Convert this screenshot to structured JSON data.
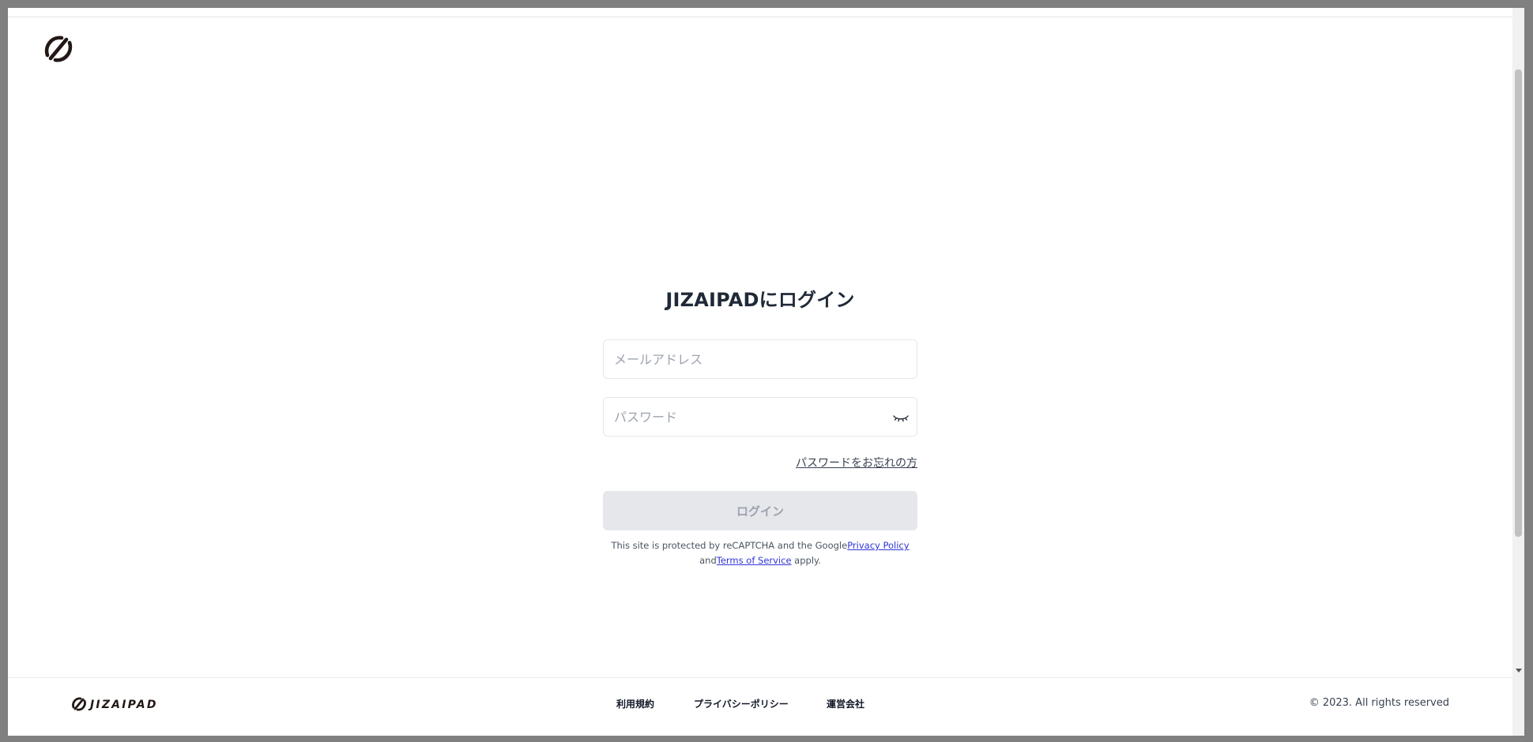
{
  "header": {
    "logo_icon": "jizaipad-mark-icon"
  },
  "login": {
    "title": "JIZAIPADにログイン",
    "email_placeholder": "メールアドレス",
    "password_placeholder": "パスワード",
    "password_toggle_icon": "eye-closed-icon",
    "forgot_password_label": "パスワードをお忘れの方",
    "submit_label": "ログイン",
    "submit_state": "disabled"
  },
  "recaptcha": {
    "text_before_privacy": "This site is protected by reCAPTCHA and the Google",
    "privacy_link_label": "Privacy Policy",
    "text_before_terms": "and",
    "terms_link_label": "Terms of Service",
    "text_after_terms": " apply."
  },
  "footer": {
    "brand_wordmark": "JIZAIPAD",
    "links": [
      {
        "label": "利用規約"
      },
      {
        "label": "プライバシーポリシー"
      },
      {
        "label": "運営会社"
      }
    ],
    "copyright": "© 2023. All rights reserved"
  },
  "colors": {
    "brand": "#231815",
    "link": "#2f35d6",
    "button_disabled_bg": "#e5e7eb",
    "button_disabled_text": "#9ca3af"
  }
}
